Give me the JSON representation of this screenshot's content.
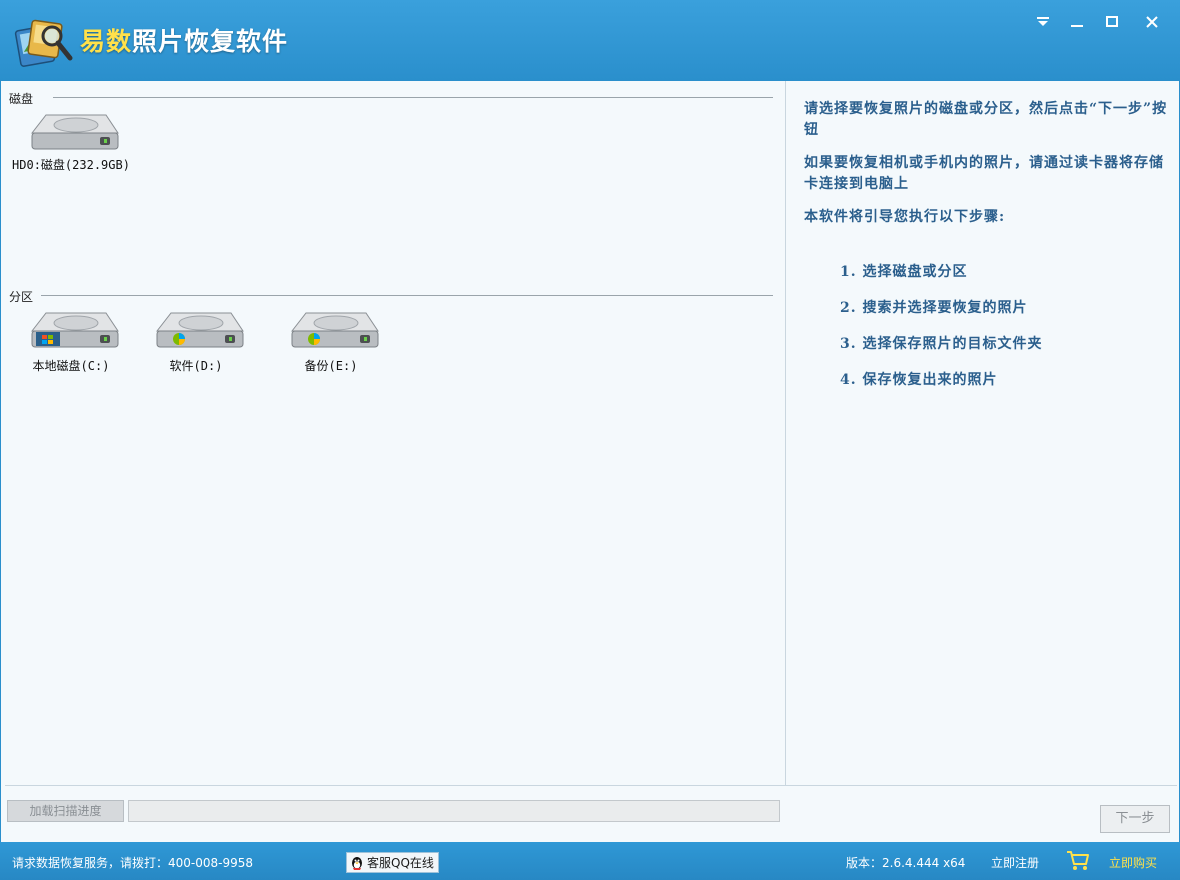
{
  "window": {
    "title_part1": "易数",
    "title_part2": "照片恢复软件",
    "controls": [
      "menu-dropdown",
      "minimize",
      "maximize",
      "close"
    ]
  },
  "disks": {
    "section_label": "磁盘",
    "items": [
      {
        "label": "HD0:磁盘(232.9GB)",
        "icon": "hard-disk-icon"
      }
    ]
  },
  "partitions": {
    "section_label": "分区",
    "items": [
      {
        "label": "本地磁盘(C:)",
        "icon": "system-drive-icon"
      },
      {
        "label": "软件(D:)",
        "icon": "partition-drive-icon"
      },
      {
        "label": "备份(E:)",
        "icon": "partition-drive-icon"
      }
    ]
  },
  "instructions": {
    "para1": "请选择要恢复照片的磁盘或分区，然后点击“下一步”按钮",
    "para2": "如果要恢复相机或手机内的照片，请通过读卡器将存储卡连接到电脑上",
    "para3": "本软件将引导您执行以下步骤:",
    "steps": [
      "1.  选择磁盘或分区",
      "2.  搜索并选择要恢复的照片",
      "3.  选择保存照片的目标文件夹",
      "4.  保存恢复出来的照片"
    ]
  },
  "bottom": {
    "load_button": "加载扫描进度",
    "progress": 0,
    "next_button": "下一步"
  },
  "status": {
    "service_text": "请求数据恢复服务，请拨打：400-008-9958",
    "qq_button": "客服QQ在线",
    "version": "版本：2.6.4.444 x64",
    "register": "立即注册",
    "buy": "立即购买"
  },
  "colors": {
    "titlebar": "#2f93cf",
    "title_highlight": "#ffe14a",
    "instruction_text": "#2b5f8d",
    "pane_bg": "#f4f9fc"
  }
}
